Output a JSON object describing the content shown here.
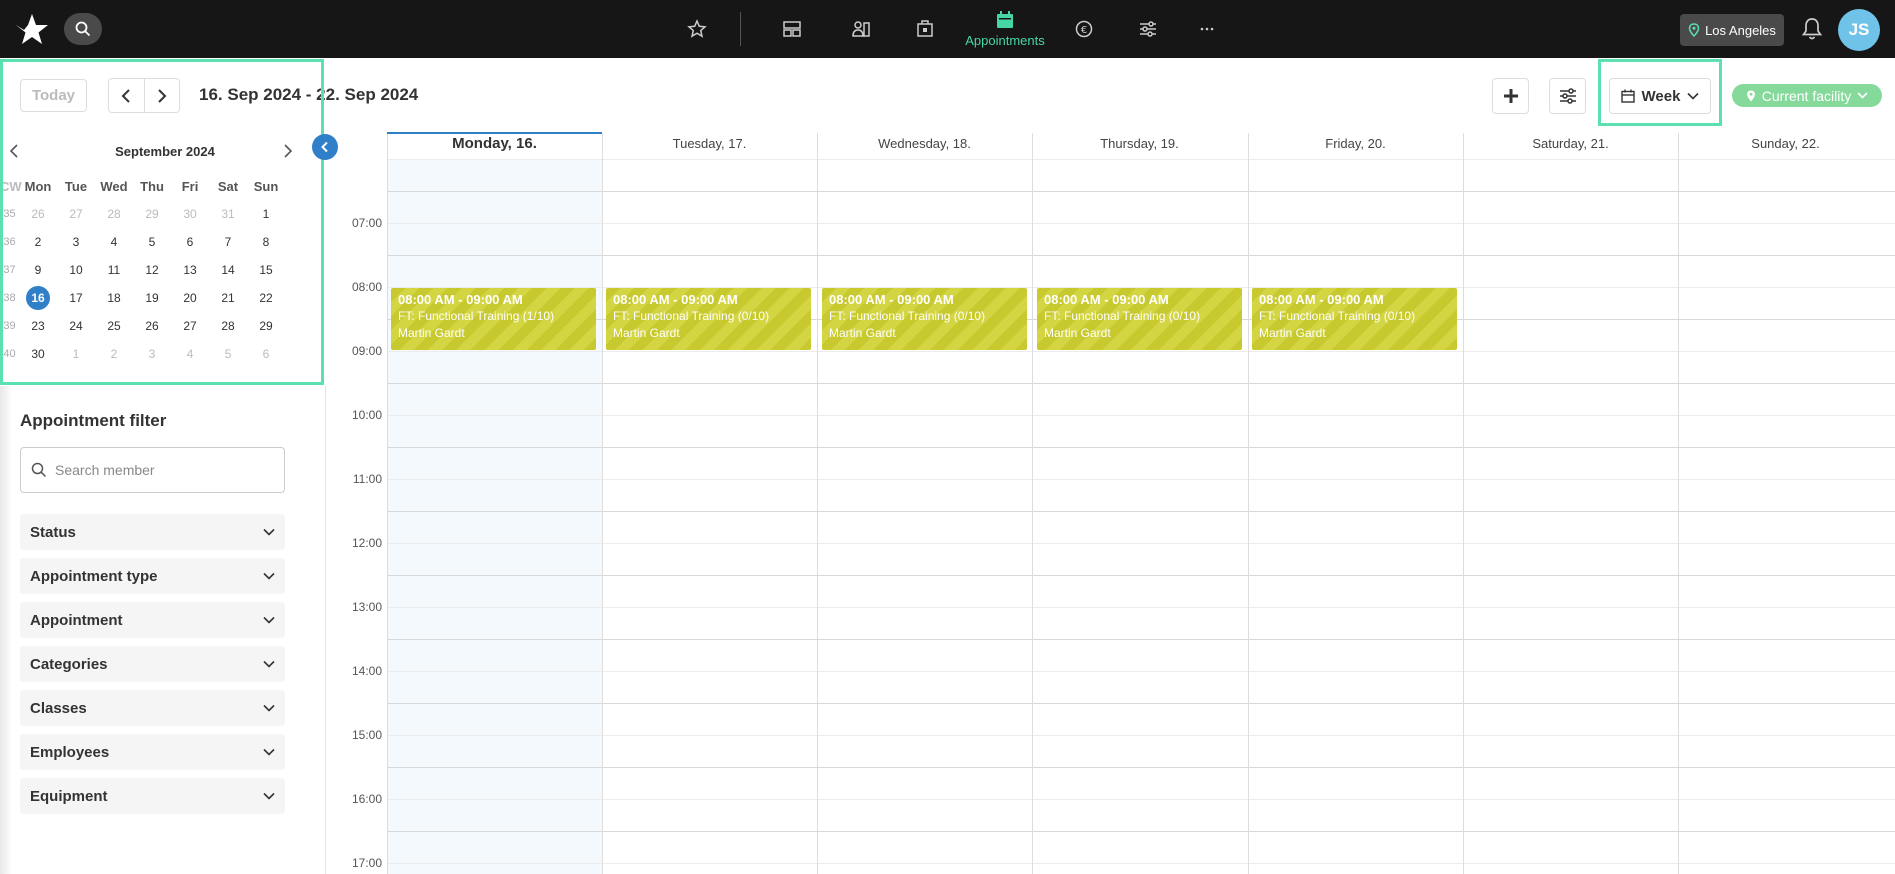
{
  "topbar": {
    "location": "Los Angeles",
    "active_nav_label": "Appointments",
    "user_initials": "JS",
    "nav_icons": [
      "star-icon",
      "dashboard-icon",
      "members-icon",
      "checkin-icon",
      "appointments-icon",
      "finance-icon",
      "settings-icon",
      "more-icon"
    ]
  },
  "toolbar": {
    "today_label": "Today",
    "date_range": "16. Sep 2024 - 22. Sep 2024",
    "view_label": "Week",
    "facility_label": "Current facility"
  },
  "mini_calendar": {
    "title": "September 2024",
    "headers": [
      "CW",
      "Mon",
      "Tue",
      "Wed",
      "Thu",
      "Fri",
      "Sat",
      "Sun"
    ],
    "weeks": [
      {
        "cw": "35",
        "days": [
          "26",
          "27",
          "28",
          "29",
          "30",
          "31",
          "1"
        ]
      },
      {
        "cw": "36",
        "days": [
          "2",
          "3",
          "4",
          "5",
          "6",
          "7",
          "8"
        ]
      },
      {
        "cw": "37",
        "days": [
          "9",
          "10",
          "11",
          "12",
          "13",
          "14",
          "15"
        ]
      },
      {
        "cw": "38",
        "days": [
          "16",
          "17",
          "18",
          "19",
          "20",
          "21",
          "22"
        ]
      },
      {
        "cw": "39",
        "days": [
          "23",
          "24",
          "25",
          "26",
          "27",
          "28",
          "29"
        ]
      },
      {
        "cw": "40",
        "days": [
          "30",
          "1",
          "2",
          "3",
          "4",
          "5",
          "6"
        ]
      }
    ],
    "selected_day": "16"
  },
  "filters": {
    "title": "Appointment filter",
    "search_placeholder": "Search member",
    "items": [
      "Status",
      "Appointment type",
      "Appointment",
      "Categories",
      "Classes",
      "Employees",
      "Equipment"
    ]
  },
  "week": {
    "days": [
      "Monday, 16.",
      "Tuesday, 17.",
      "Wednesday, 18.",
      "Thursday, 19.",
      "Friday, 20.",
      "Saturday, 21.",
      "Sunday, 22."
    ],
    "times": [
      "07:00",
      "08:00",
      "09:00",
      "10:00",
      "11:00",
      "12:00",
      "13:00",
      "14:00",
      "15:00",
      "16:00",
      "17:00"
    ]
  },
  "events": [
    {
      "time": "08:00 AM - 09:00 AM",
      "title": "FT: Functional Training (1/10)",
      "trainer": "Martin Gardt"
    },
    {
      "time": "08:00 AM - 09:00 AM",
      "title": "FT: Functional Training (0/10)",
      "trainer": "Martin Gardt"
    },
    {
      "time": "08:00 AM - 09:00 AM",
      "title": "FT: Functional Training (0/10)",
      "trainer": "Martin Gardt"
    },
    {
      "time": "08:00 AM - 09:00 AM",
      "title": "FT: Functional Training (0/10)",
      "trainer": "Martin Gardt"
    },
    {
      "time": "08:00 AM - 09:00 AM",
      "title": "FT: Functional Training (0/10)",
      "trainer": "Martin Gardt"
    }
  ],
  "colors": {
    "accent": "#46d6a6",
    "event": "#c7c92e",
    "selected": "#2f7fc9",
    "facility": "#85d99a"
  }
}
